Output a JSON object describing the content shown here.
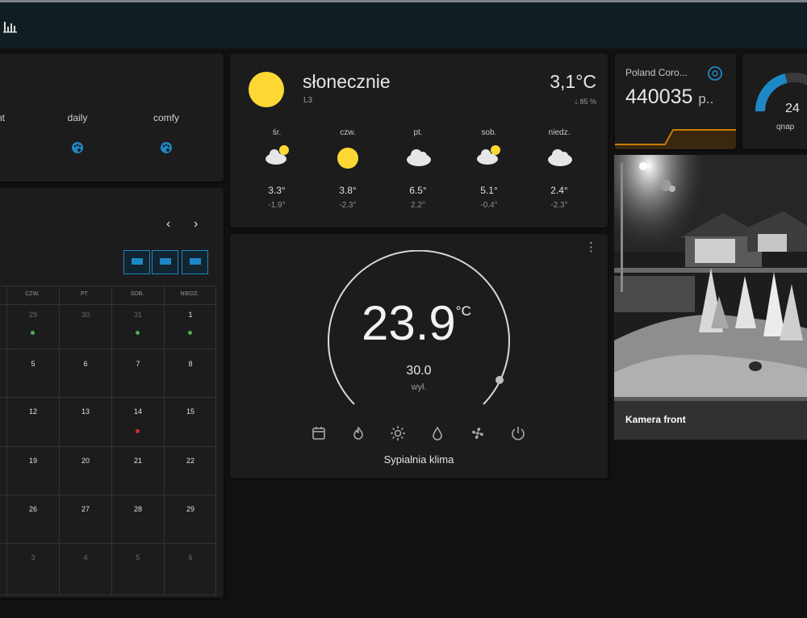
{
  "topbar": {
    "icon": "bar-chart-icon"
  },
  "modes": {
    "items": [
      {
        "label": "nt",
        "icon": "none"
      },
      {
        "label": "daily",
        "icon": "palette-icon"
      },
      {
        "label": "comfy",
        "icon": "palette-icon"
      }
    ],
    "accent": "#1e88c7"
  },
  "calendar": {
    "nav_prev": "‹",
    "nav_next": "›",
    "weekdays": [
      "CZW.",
      "PT.",
      "SOB.",
      "NIEDZ."
    ],
    "rows": [
      [
        "29",
        "30",
        "31",
        "1"
      ],
      [
        "5",
        "6",
        "7",
        "8"
      ],
      [
        "12",
        "13",
        "14",
        "15"
      ],
      [
        "19",
        "20",
        "21",
        "22"
      ],
      [
        "26",
        "27",
        "28",
        "29"
      ],
      [
        "3",
        "4",
        "5",
        "6"
      ]
    ],
    "event_colors": {
      "green": "#4caf50",
      "red": "#d32f2f"
    }
  },
  "weather": {
    "condition": "słonecznie",
    "subtitle": "L3",
    "temperature": "3,1°C",
    "humidity": "85 %",
    "forecast": [
      {
        "day": "śr.",
        "icon": "partly-cloudy-icon",
        "high": "3.3°",
        "low": "-1.9°"
      },
      {
        "day": "czw.",
        "icon": "sun-icon",
        "high": "3.8°",
        "low": "-2.3°"
      },
      {
        "day": "pt.",
        "icon": "cloud-icon",
        "high": "6.5°",
        "low": "2.2°"
      },
      {
        "day": "sob.",
        "icon": "partly-cloudy-icon",
        "high": "5.1°",
        "low": "-0.4°"
      },
      {
        "day": "niedz.",
        "icon": "cloud-icon",
        "high": "2.4°",
        "low": "-2.3°"
      }
    ]
  },
  "corona": {
    "title": "Poland Coro...",
    "value": "440035",
    "unit": "p..",
    "accent": "#c8790a"
  },
  "gauge": {
    "value": "24",
    "label": "qnap",
    "accent": "#1e88c7"
  },
  "thermostat": {
    "current": "23.9",
    "unit": "°C",
    "target": "30.0",
    "state": "wył.",
    "name": "Sypialnia klima",
    "modes": [
      "calendar-icon",
      "fire-icon",
      "sun-icon",
      "drop-icon",
      "fan-icon",
      "power-icon"
    ]
  },
  "camera": {
    "label": "Kamera front"
  }
}
